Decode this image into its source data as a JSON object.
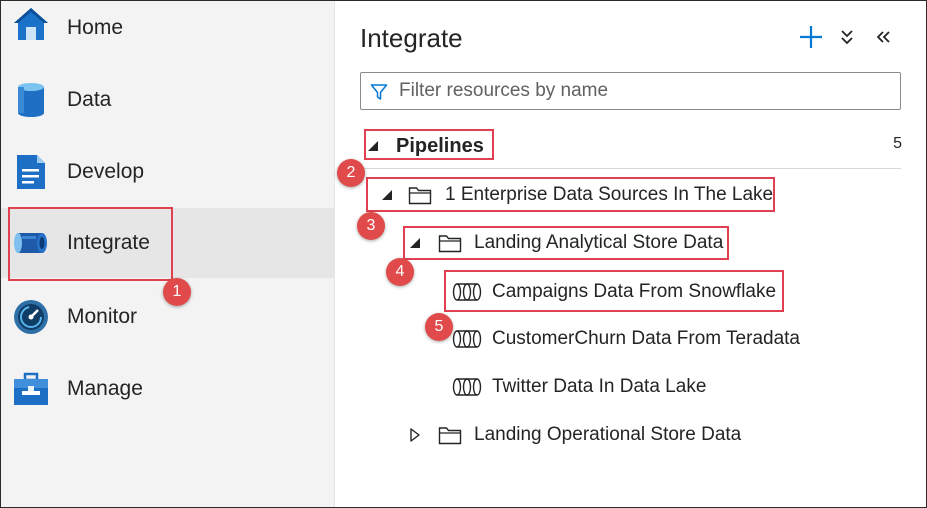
{
  "sidebar": {
    "items": [
      {
        "label": "Home",
        "icon": "home-icon"
      },
      {
        "label": "Data",
        "icon": "database-icon"
      },
      {
        "label": "Develop",
        "icon": "document-icon"
      },
      {
        "label": "Integrate",
        "icon": "pipeline-icon",
        "active": true
      },
      {
        "label": "Monitor",
        "icon": "gauge-icon"
      },
      {
        "label": "Manage",
        "icon": "toolbox-icon"
      }
    ]
  },
  "main": {
    "title": "Integrate",
    "filter_placeholder": "Filter resources by name",
    "section": {
      "label": "Pipelines",
      "count": "5"
    },
    "tree": {
      "folder1": "1 Enterprise Data Sources In The Lake",
      "folder2": "Landing Analytical Store Data",
      "pipeline1": "Campaigns Data From Snowflake",
      "pipeline2": "CustomerChurn Data From Teradata",
      "pipeline3": "Twitter Data In Data Lake",
      "folder3": "Landing Operational Store Data"
    }
  },
  "annotations": {
    "badges": [
      "1",
      "2",
      "3",
      "4",
      "5"
    ],
    "color": "#e04050"
  },
  "colors": {
    "accent": "#0078d4",
    "sidebar_bg": "#f3f3f3",
    "active_bg": "#e6e6e6"
  }
}
